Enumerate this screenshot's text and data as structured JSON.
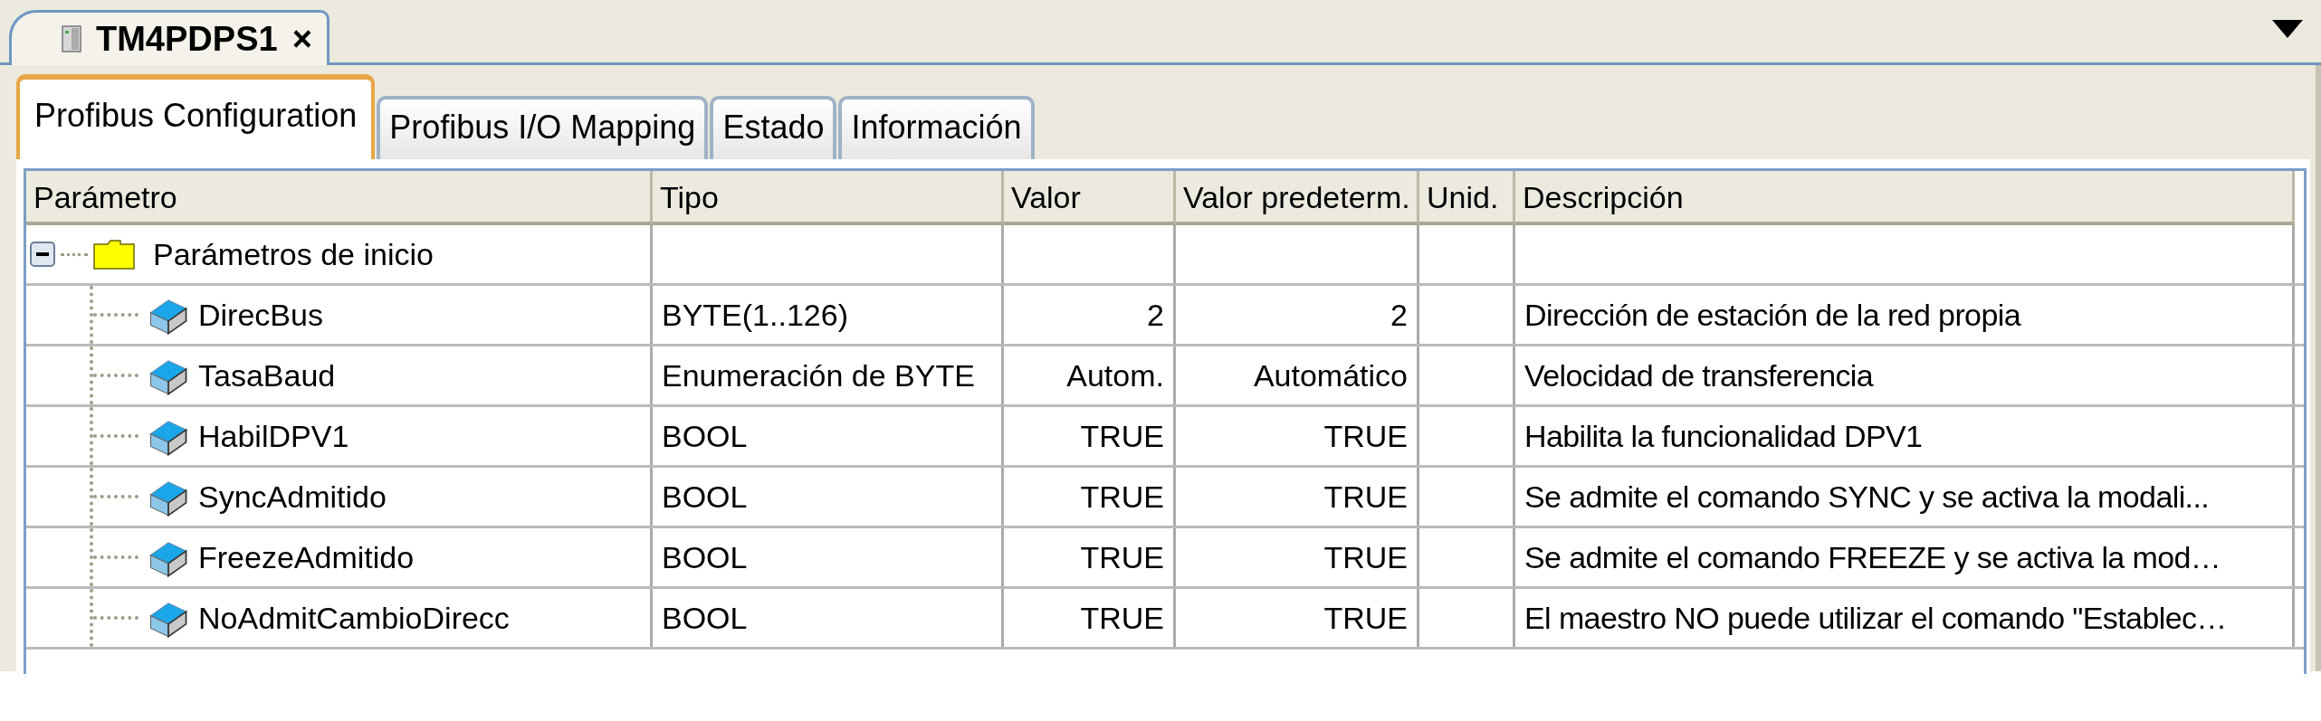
{
  "document_tab": {
    "title": "TM4PDPS1",
    "close": "×",
    "selected": true
  },
  "tabs": [
    {
      "label": "Profibus Configuration",
      "selected": true
    },
    {
      "label": "Profibus I/O Mapping",
      "selected": false
    },
    {
      "label": "Estado",
      "selected": false
    },
    {
      "label": "Información",
      "selected": false
    }
  ],
  "table": {
    "columns": [
      "Parámetro",
      "Tipo",
      "Valor",
      "Valor predeterm.",
      "Unid.",
      "Descripción"
    ],
    "rows": [
      {
        "name": "Parámetros de inicio",
        "kind": "folder",
        "expanded": true,
        "children": [
          {
            "name": "DirecBus",
            "kind": "parameter",
            "type": "BYTE(1..126)",
            "value": "2",
            "default": "2",
            "description": "Dirección de estación de la red propia"
          },
          {
            "name": "TasaBaud",
            "kind": "parameter",
            "type": "Enumeración de BYTE",
            "value": "Autom.",
            "default": "Automático",
            "description": "Velocidad de transferencia"
          },
          {
            "name": "HabilDPV1",
            "kind": "parameter",
            "type": "BOOL",
            "value": "TRUE",
            "default": "TRUE",
            "description": "Habilita la funcionalidad DPV1"
          },
          {
            "name": "SyncAdmitido",
            "kind": "parameter",
            "type": "BOOL",
            "value": "TRUE",
            "default": "TRUE",
            "description": "Se admite el comando SYNC y se activa la modali..."
          },
          {
            "name": "FreezeAdmitido",
            "kind": "parameter",
            "type": "BOOL",
            "value": "TRUE",
            "default": "TRUE",
            "description": "Se admite el comando FREEZE y se activa la mod…"
          },
          {
            "name": "NoAdmitCambioDirecc",
            "kind": "parameter",
            "type": "BOOL",
            "value": "TRUE",
            "default": "TRUE",
            "description": "El maestro NO puede utilizar el comando \"Establec…"
          }
        ]
      }
    ]
  }
}
